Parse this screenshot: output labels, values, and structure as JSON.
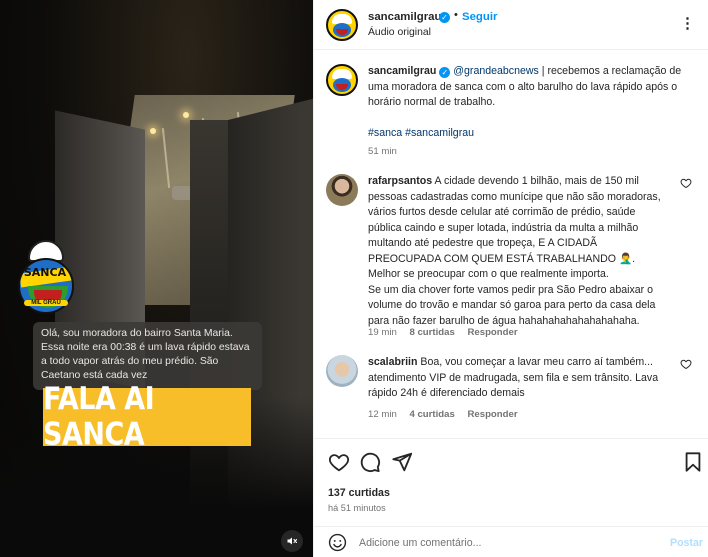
{
  "media": {
    "sticker_text": "SANCA",
    "sticker_subtext": "MIL GRAU",
    "caption": "Olá, sou moradora do bairro Santa Maria. Essa noite era 00:38 é um lava rápido estava a todo vapor atrás do meu prédio. São Caetano está cada vez",
    "banner": "FALA AI SANCA",
    "mute_icon": "speaker-muted-icon"
  },
  "header": {
    "username": "sancamilgrau",
    "separator": "•",
    "follow_label": "Seguir",
    "audio": "Áudio original",
    "more_label": "⋮"
  },
  "post": {
    "username": "sancamilgrau",
    "mention": "@grandeabcnews",
    "body": " | recebemos a reclamação de uma moradora de sanca com o alto barulho do lava rápido após o horário normal de trabalho.",
    "hashtags": "#sanca #sancamilgrau",
    "time": "51 min"
  },
  "comments": [
    {
      "username": "rafarpsantos",
      "text": "A cidade devendo 1 bilhão, mais de 150 mil pessoas cadastradas como munícipe que não são moradoras, vários furtos desde celular até corrimão de prédio, saúde pública caindo e super lotada, indústria da multa a milhão multando até pedestre que tropeça, E A CIDADÃ PREOCUPADA COM QUEM ESTÁ TRABALHANDO 🤦‍♂️. Melhor se preocupar com o que realmente importa.",
      "text2": "Se um dia chover forte vamos pedir pra São Pedro abaixar o volume do trovão e mandar só garoa para perto da casa dela para não fazer barulho de água hahahahahahahahahaha.",
      "time": "19 min",
      "likes": "8 curtidas",
      "reply": "Responder"
    },
    {
      "username": "scalabriin",
      "text": "Boa, vou começar a lavar meu carro aí também... atendimento VIP de madrugada, sem fila e sem trânsito. Lava rápido 24h é diferenciado demais",
      "time": "12 min",
      "likes": "4 curtidas",
      "reply": "Responder"
    }
  ],
  "actions": {
    "likes": "137 curtidas",
    "time": "há 51 minutos"
  },
  "add_comment": {
    "placeholder": "Adicione um comentário...",
    "post_label": "Postar"
  },
  "colors": {
    "accent": "#0095f6",
    "link": "#00376b",
    "muted": "#737373",
    "banner": "#f8be2a"
  }
}
